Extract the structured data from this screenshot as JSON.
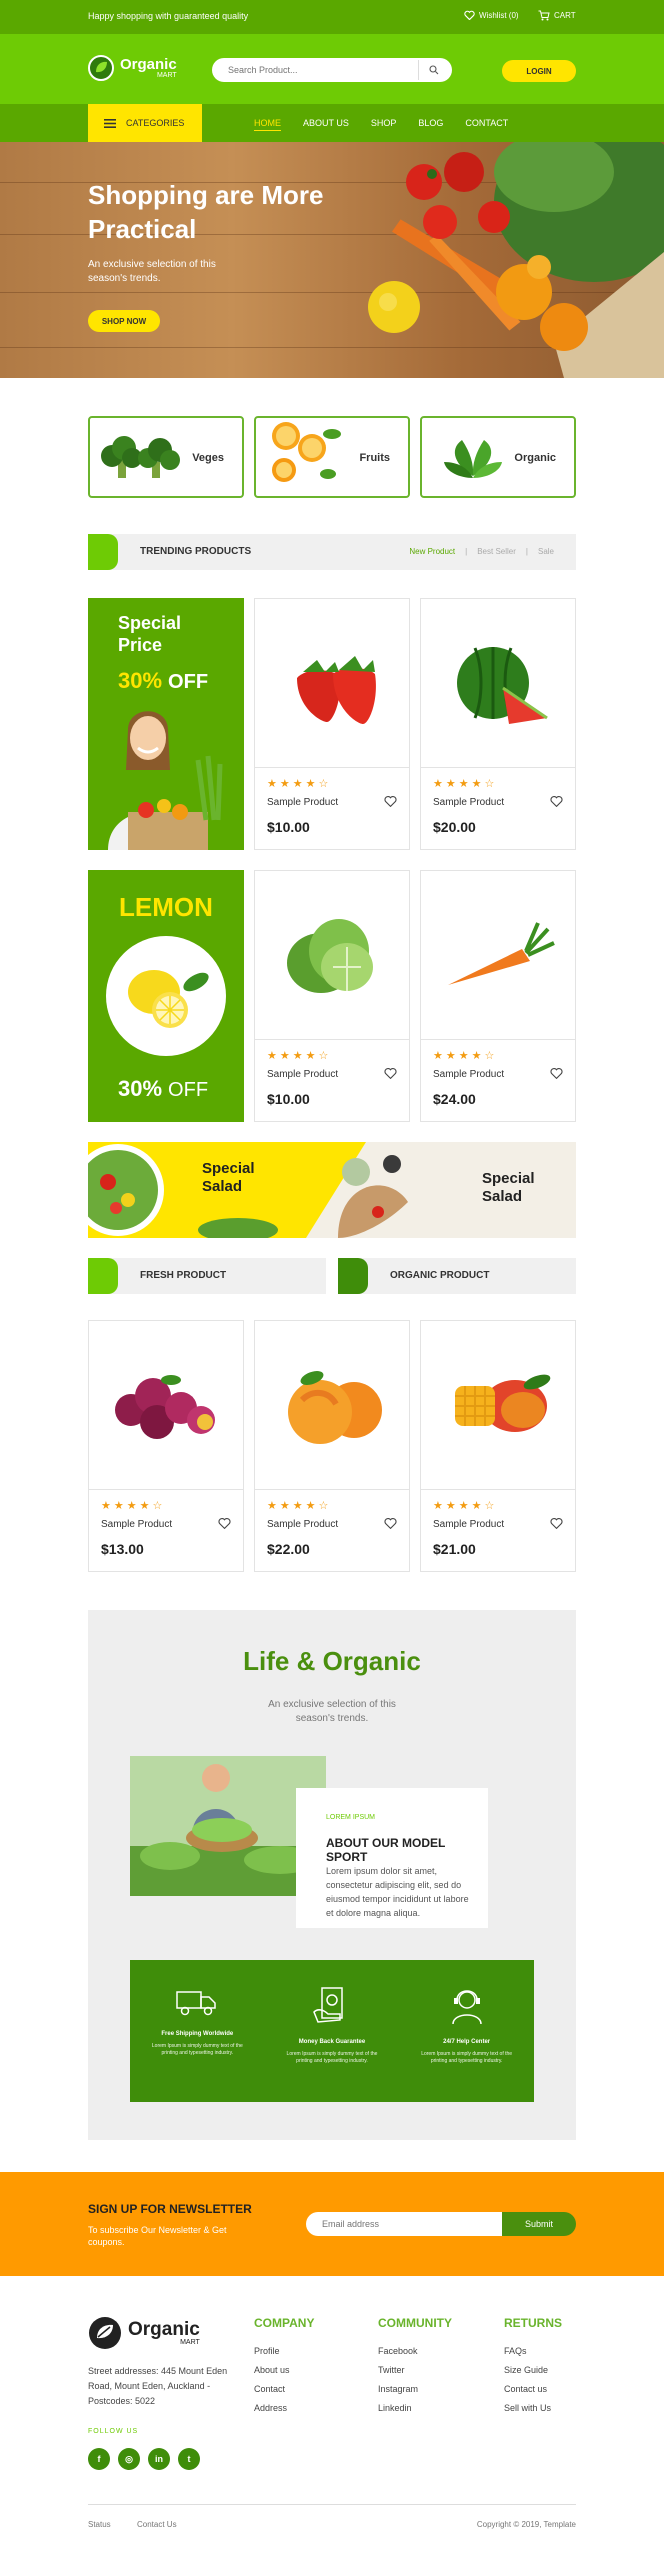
{
  "topbar": {
    "tagline": "Happy shopping with guaranteed quality",
    "wishlist": "Wishlist (0)",
    "cart": "CART"
  },
  "header": {
    "logo_main": "Organic",
    "logo_sub": "MART",
    "search_placeholder": "Search Product...",
    "login": "LOGIN"
  },
  "nav": {
    "categories": "CATEGORIES",
    "items": [
      {
        "label": "HOME",
        "active": true
      },
      {
        "label": "ABOUT US",
        "active": false
      },
      {
        "label": "SHOP",
        "active": false
      },
      {
        "label": "BLOG",
        "active": false
      },
      {
        "label": "CONTACT",
        "active": false
      }
    ]
  },
  "hero": {
    "title": "Shopping are More Practical",
    "subtitle": "An exclusive selection of this season's trends.",
    "cta": "SHOP NOW"
  },
  "categories": [
    {
      "label": "Veges"
    },
    {
      "label": "Fruits"
    },
    {
      "label": "Organic"
    }
  ],
  "trending": {
    "title": "TRENDING PRODUCTS",
    "filters": [
      "New Product",
      "Best Seller",
      "Sale"
    ],
    "promo1": {
      "title": "Special Price",
      "discount": "30%",
      "off": "OFF"
    },
    "promo2": {
      "title": "LEMON",
      "discount": "30%",
      "off": "OFF"
    },
    "products": [
      {
        "name": "Sample Product",
        "price": "$10.00",
        "rating": 4,
        "icon": "strawberry"
      },
      {
        "name": "Sample Product",
        "price": "$20.00",
        "rating": 4,
        "icon": "watermelon"
      },
      {
        "name": "Sample Product",
        "price": "$10.00",
        "rating": 4,
        "icon": "lettuce"
      },
      {
        "name": "Sample Product",
        "price": "$24.00",
        "rating": 4,
        "icon": "carrot"
      }
    ]
  },
  "salad_banner": {
    "left": "Special Salad",
    "right": "Special Salad"
  },
  "fresh": {
    "title1": "FRESH PRODUCT",
    "title2": "ORGANIC PRODUCT",
    "products": [
      {
        "name": "Sample Product",
        "price": "$13.00",
        "rating": 4,
        "icon": "plums"
      },
      {
        "name": "Sample Product",
        "price": "$22.00",
        "rating": 4,
        "icon": "peaches"
      },
      {
        "name": "Sample Product",
        "price": "$21.00",
        "rating": 4,
        "icon": "mango"
      }
    ]
  },
  "about": {
    "title": "Life & Organic",
    "subtitle": "An exclusive selection of this season's trends.",
    "kicker": "LOREM IPSUM",
    "heading": "ABOUT OUR MODEL SPORT",
    "body": "Lorem ipsum dolor sit amet, consectetur adipiscing elit, sed do eiusmod tempor incididunt ut labore et dolore magna aliqua.",
    "features": [
      {
        "title": "Free Shipping Worldwide",
        "desc": "Lorem Ipsum is simply dummy text of the printing and typesetting industry.",
        "icon": "truck-icon"
      },
      {
        "title": "Money Back Guarantee",
        "desc": "Lorem Ipsum is simply dummy text of the printing and typesetting industry.",
        "icon": "money-icon"
      },
      {
        "title": "24/7 Help Center",
        "desc": "Lorem Ipsum is simply dummy text of the printing and typesetting industry.",
        "icon": "support-icon"
      }
    ]
  },
  "newsletter": {
    "title": "SIGN UP FOR NEWSLETTER",
    "desc": "To subscribe Our Newsletter & Get coupons.",
    "placeholder": "Email address",
    "button": "Submit"
  },
  "footer": {
    "logo_main": "Organic",
    "logo_sub": "MART",
    "address": "Street addresses: 445 Mount Eden Road, Mount Eden, Auckland - Postcodes: 5022",
    "follow": "FOLLOW US",
    "columns": [
      {
        "title": "COMPANY",
        "items": [
          "Profile",
          "About us",
          "Contact",
          "Address"
        ]
      },
      {
        "title": "COMMUNITY",
        "items": [
          "Facebook",
          "Twitter",
          "Instagram",
          "Linkedin"
        ]
      },
      {
        "title": "RETURNS",
        "items": [
          "FAQs",
          "Size Guide",
          "Contact us",
          "Sell with Us"
        ]
      }
    ],
    "bottom_links": [
      "Status",
      "Contact Us"
    ],
    "copyright": "Copyright © 2019, Template"
  },
  "colors": {
    "brand_green": "#6ecb05",
    "dark_green": "#5aa800",
    "yellow": "#ffe500",
    "orange": "#ff9a00"
  }
}
